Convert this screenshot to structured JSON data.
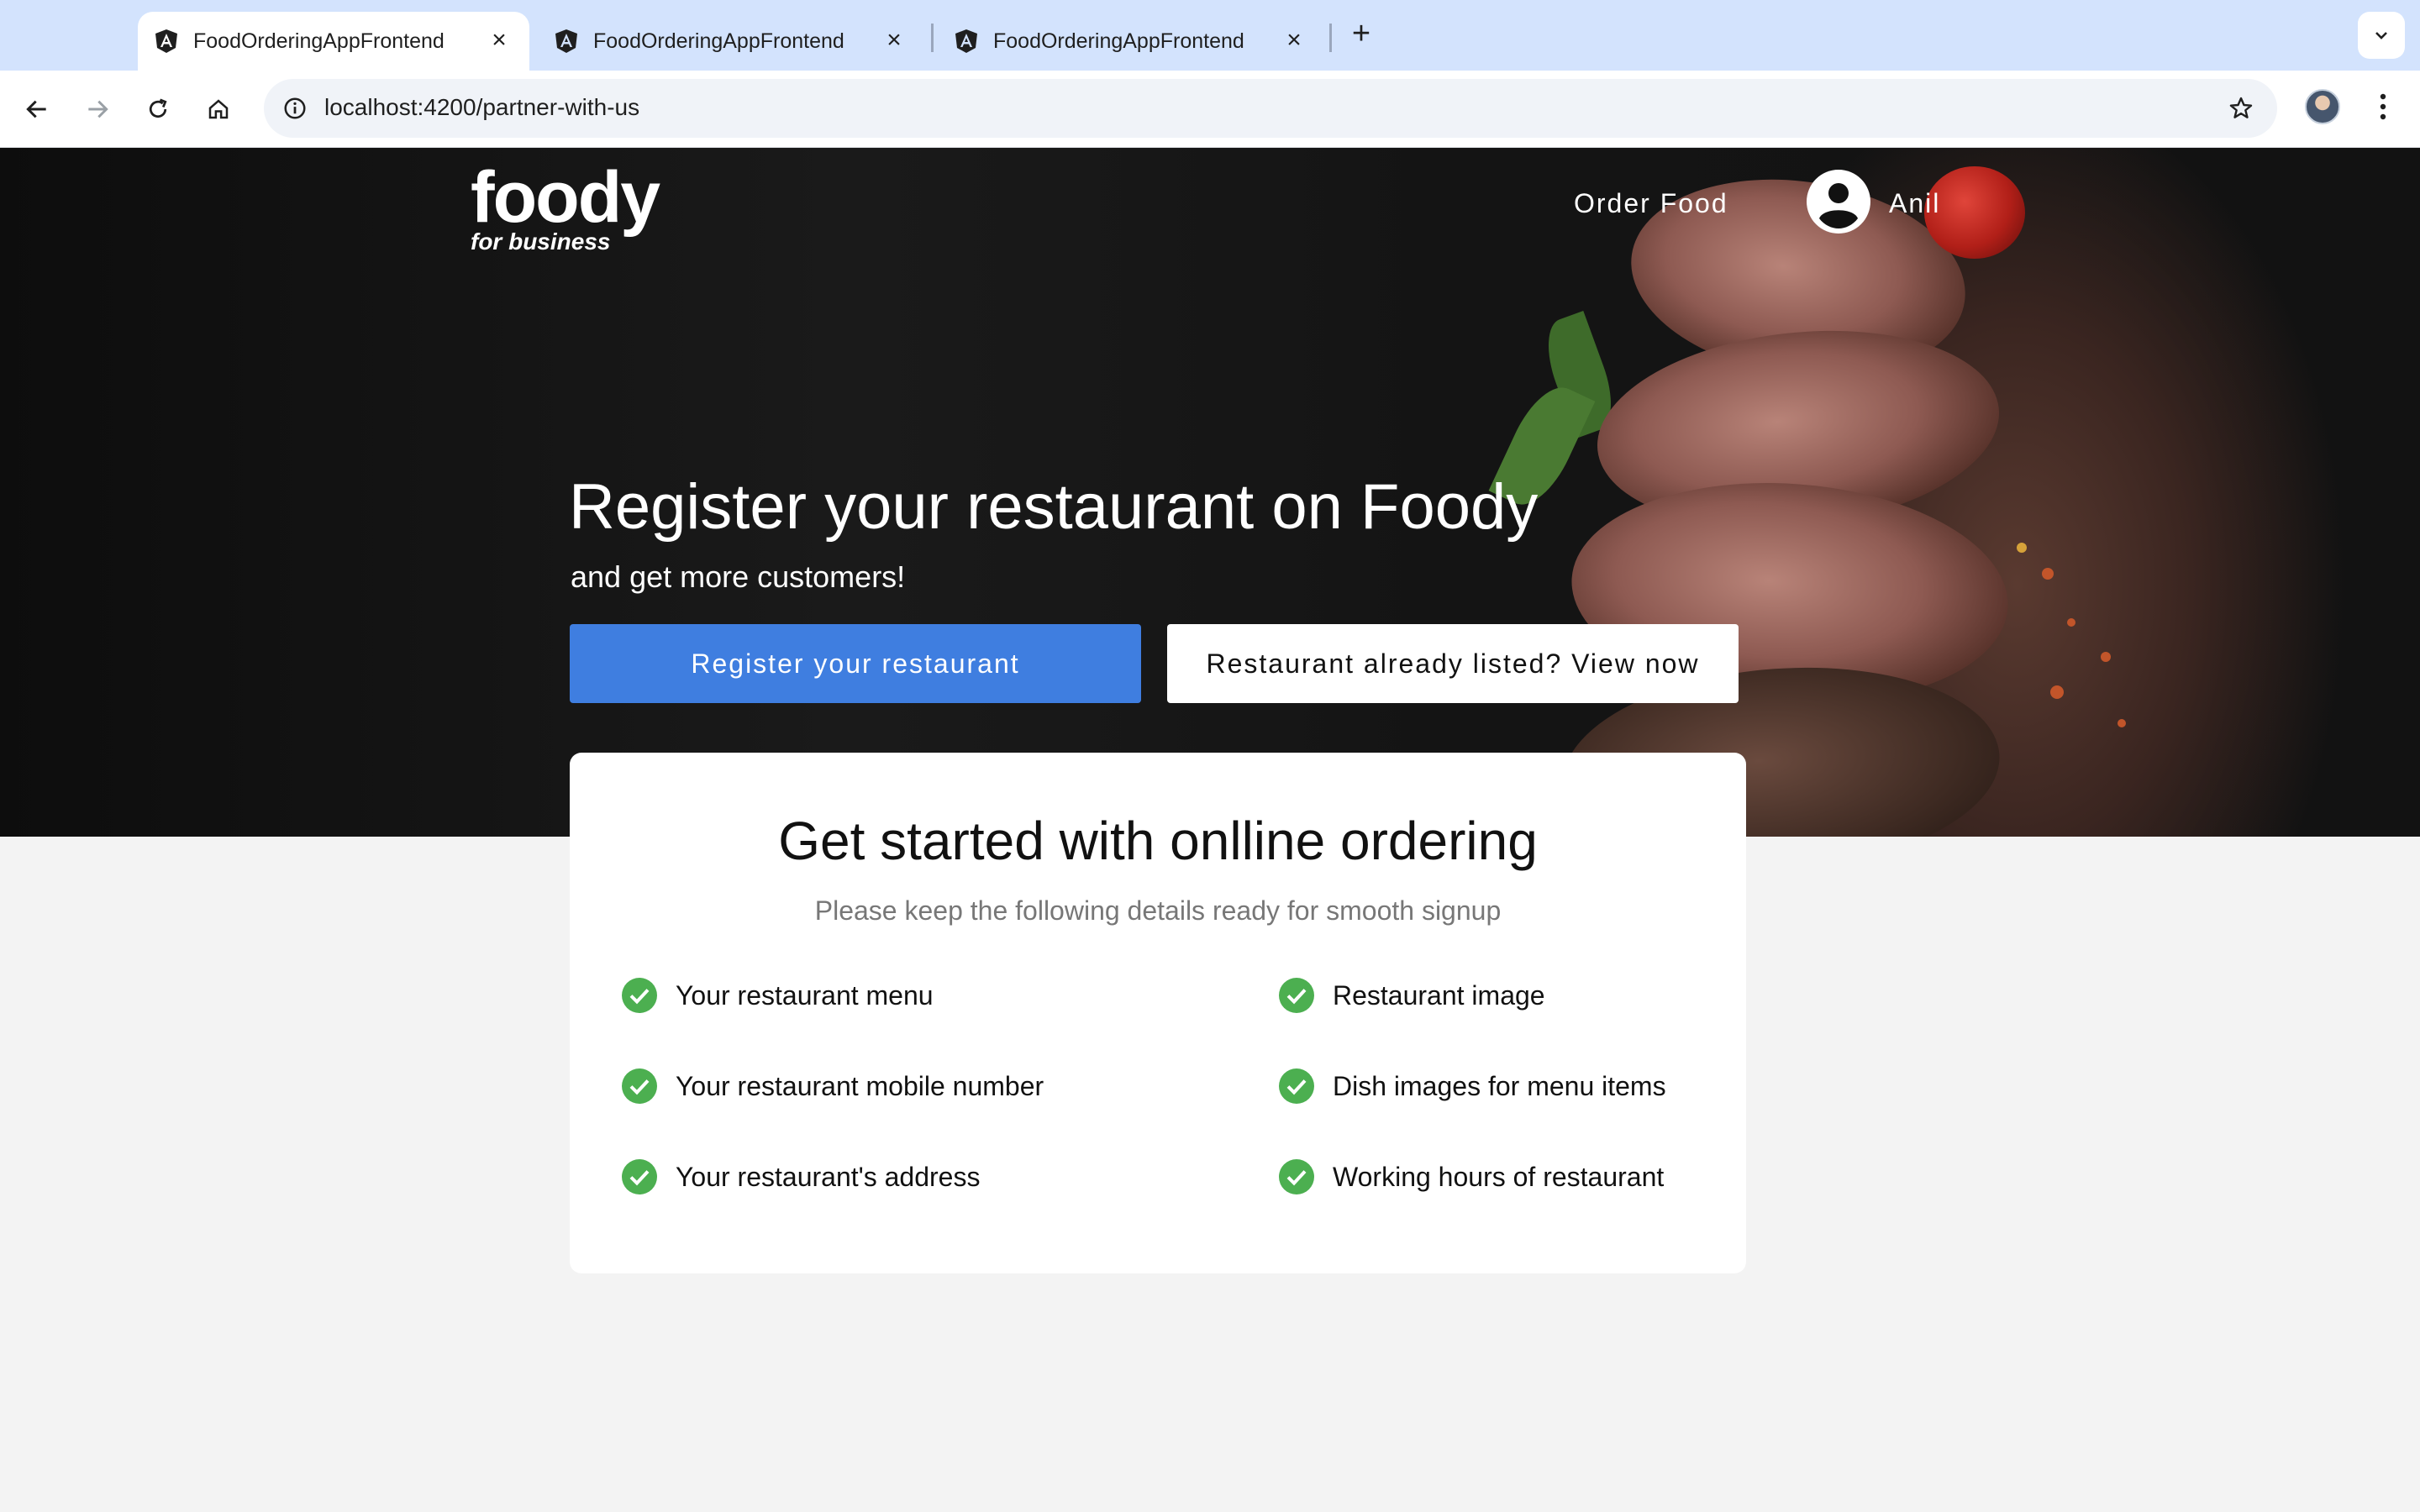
{
  "browser": {
    "tabs": [
      {
        "title": "FoodOrderingAppFrontend",
        "active": true
      },
      {
        "title": "FoodOrderingAppFrontend",
        "active": false
      },
      {
        "title": "FoodOrderingAppFrontend",
        "active": false
      }
    ],
    "url": "localhost:4200/partner-with-us"
  },
  "header": {
    "logo": "foody",
    "logo_sub": "for business",
    "order_food": "Order Food",
    "user_name": "Anil"
  },
  "hero": {
    "title": "Register your restaurant on Foody",
    "subtitle": "and get more customers!",
    "primary_button": "Register your restaurant",
    "secondary_button": "Restaurant already listed? View now"
  },
  "card": {
    "title": "Get started with onlline ordering",
    "subtitle": "Please keep the following details ready for smooth signup",
    "items_left": [
      "Your restaurant menu",
      "Your restaurant mobile number",
      "Your restaurant's address"
    ],
    "items_right": [
      "Restaurant image",
      "Dish images for menu items",
      "Working hours of restaurant"
    ]
  },
  "colors": {
    "primary_button": "#3f7ee0",
    "check": "#4caf50",
    "tabstrip": "#d3e3fd"
  },
  "icons": [
    "angular-icon",
    "close-icon",
    "plus-icon",
    "chevron-down-icon",
    "back-arrow-icon",
    "forward-arrow-icon",
    "reload-icon",
    "home-icon",
    "info-icon",
    "star-icon",
    "more-vert-icon",
    "account-circle-icon",
    "check-circle-icon"
  ]
}
